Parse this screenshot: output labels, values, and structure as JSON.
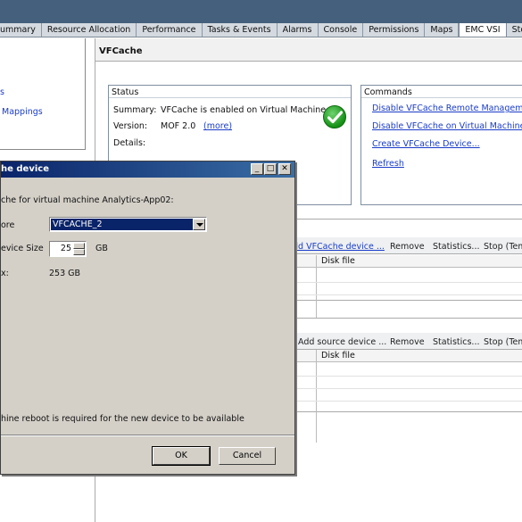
{
  "tabs": [
    {
      "label": "ummary",
      "active": false
    },
    {
      "label": "Resource Allocation",
      "active": false
    },
    {
      "label": "Performance",
      "active": false
    },
    {
      "label": "Tasks & Events",
      "active": false
    },
    {
      "label": "Alarms",
      "active": false
    },
    {
      "label": "Console",
      "active": false
    },
    {
      "label": "Permissions",
      "active": false
    },
    {
      "label": "Maps",
      "active": false
    },
    {
      "label": "EMC VSI",
      "active": true
    },
    {
      "label": "Storage V",
      "active": false
    }
  ],
  "left_nav": {
    "item_1": "s",
    "item_2": "Mappings"
  },
  "section_title": "VFCache",
  "status": {
    "title": "Status",
    "summary_label": "Summary:",
    "summary_value": "VFCache is enabled on Virtual Machine",
    "version_label": "Version:",
    "version_value": "MOF 2.0",
    "more_link": "(more)",
    "details_label": "Details:",
    "status_icon": "green-checkmark-icon"
  },
  "commands": {
    "title": "Commands",
    "items": [
      "Disable VFCache Remote Management",
      "Disable VFCache on Virtual Machine",
      "Create VFCache Device...",
      "Refresh"
    ]
  },
  "table1": {
    "toolbar": [
      "dd VFCache device ...",
      "Remove",
      "Statistics...",
      "Stop (Tem"
    ],
    "column": "Disk file"
  },
  "table2": {
    "toolbar": [
      "Add source device ...",
      "Remove",
      "Statistics...",
      "Stop (Tem"
    ],
    "column": "Disk file"
  },
  "dialog": {
    "title": "he device",
    "description": "che for virtual machine Analytics-App02:",
    "store_label": "ore",
    "store_value": "VFCACHE_2",
    "size_label": "evice Size",
    "size_value": "25",
    "size_unit": "GB",
    "free_label": "x:",
    "free_value": "253 GB",
    "note": "hine reboot is required for the new device to be available",
    "ok_label": "OK",
    "cancel_label": "Cancel",
    "min_symbol": "_",
    "max_symbol": "□",
    "close_symbol": "✕"
  }
}
